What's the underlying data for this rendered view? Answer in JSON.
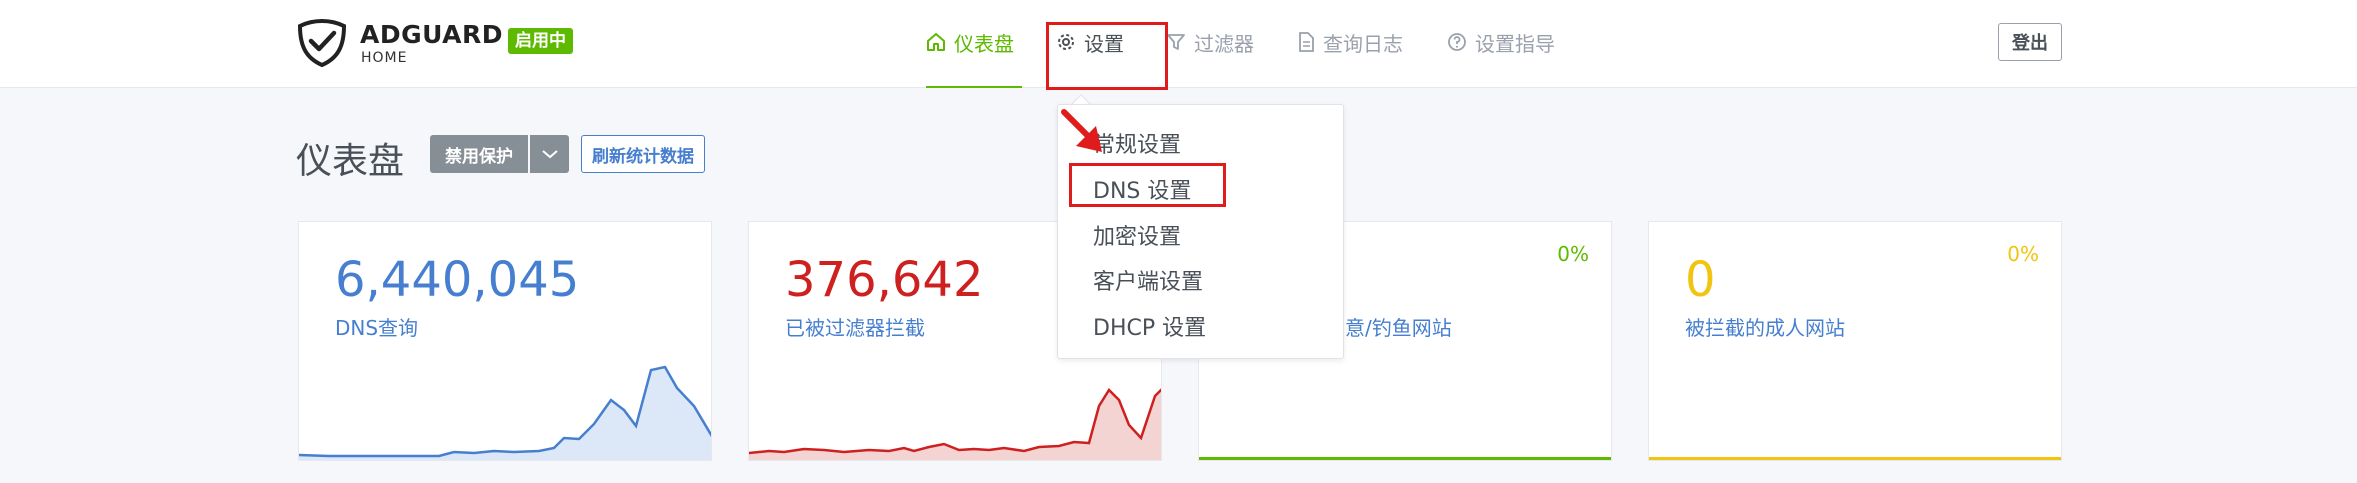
{
  "header": {
    "brand": "ADGUARD",
    "brand_sub": "HOME",
    "status_badge": "启用中",
    "nav": [
      {
        "label": "仪表盘",
        "icon": "home-icon"
      },
      {
        "label": "设置",
        "icon": "gear-icon"
      },
      {
        "label": "过滤器",
        "icon": "filter-icon"
      },
      {
        "label": "查询日志",
        "icon": "document-icon"
      },
      {
        "label": "设置指导",
        "icon": "help-circle-icon"
      }
    ],
    "logout": "登出"
  },
  "page": {
    "title": "仪表盘",
    "disable_protection": "禁用保护",
    "refresh_stats": "刷新统计数据"
  },
  "cards": [
    {
      "value": "6,440,045",
      "label": "DNS查询",
      "pct": "",
      "color": "#467fcf"
    },
    {
      "value": "376,642",
      "label": "已被过滤器拦截",
      "pct": "",
      "color": "#cd201f"
    },
    {
      "value": "",
      "label": "意/钓鱼网站",
      "pct": "0%",
      "color": "#5eba00"
    },
    {
      "value": "0",
      "label": "被拦截的成人网站",
      "pct": "0%",
      "color": "#f1c40f"
    }
  ],
  "dropdown": {
    "items": [
      "常规设置",
      "DNS 设置",
      "加密设置",
      "客户端设置",
      "DHCP 设置"
    ]
  },
  "colors": {
    "accent_green": "#5eba00",
    "blue": "#467fcf",
    "red": "#cd201f",
    "yellow": "#f1c40f",
    "annotation_red": "#e01b1b"
  }
}
